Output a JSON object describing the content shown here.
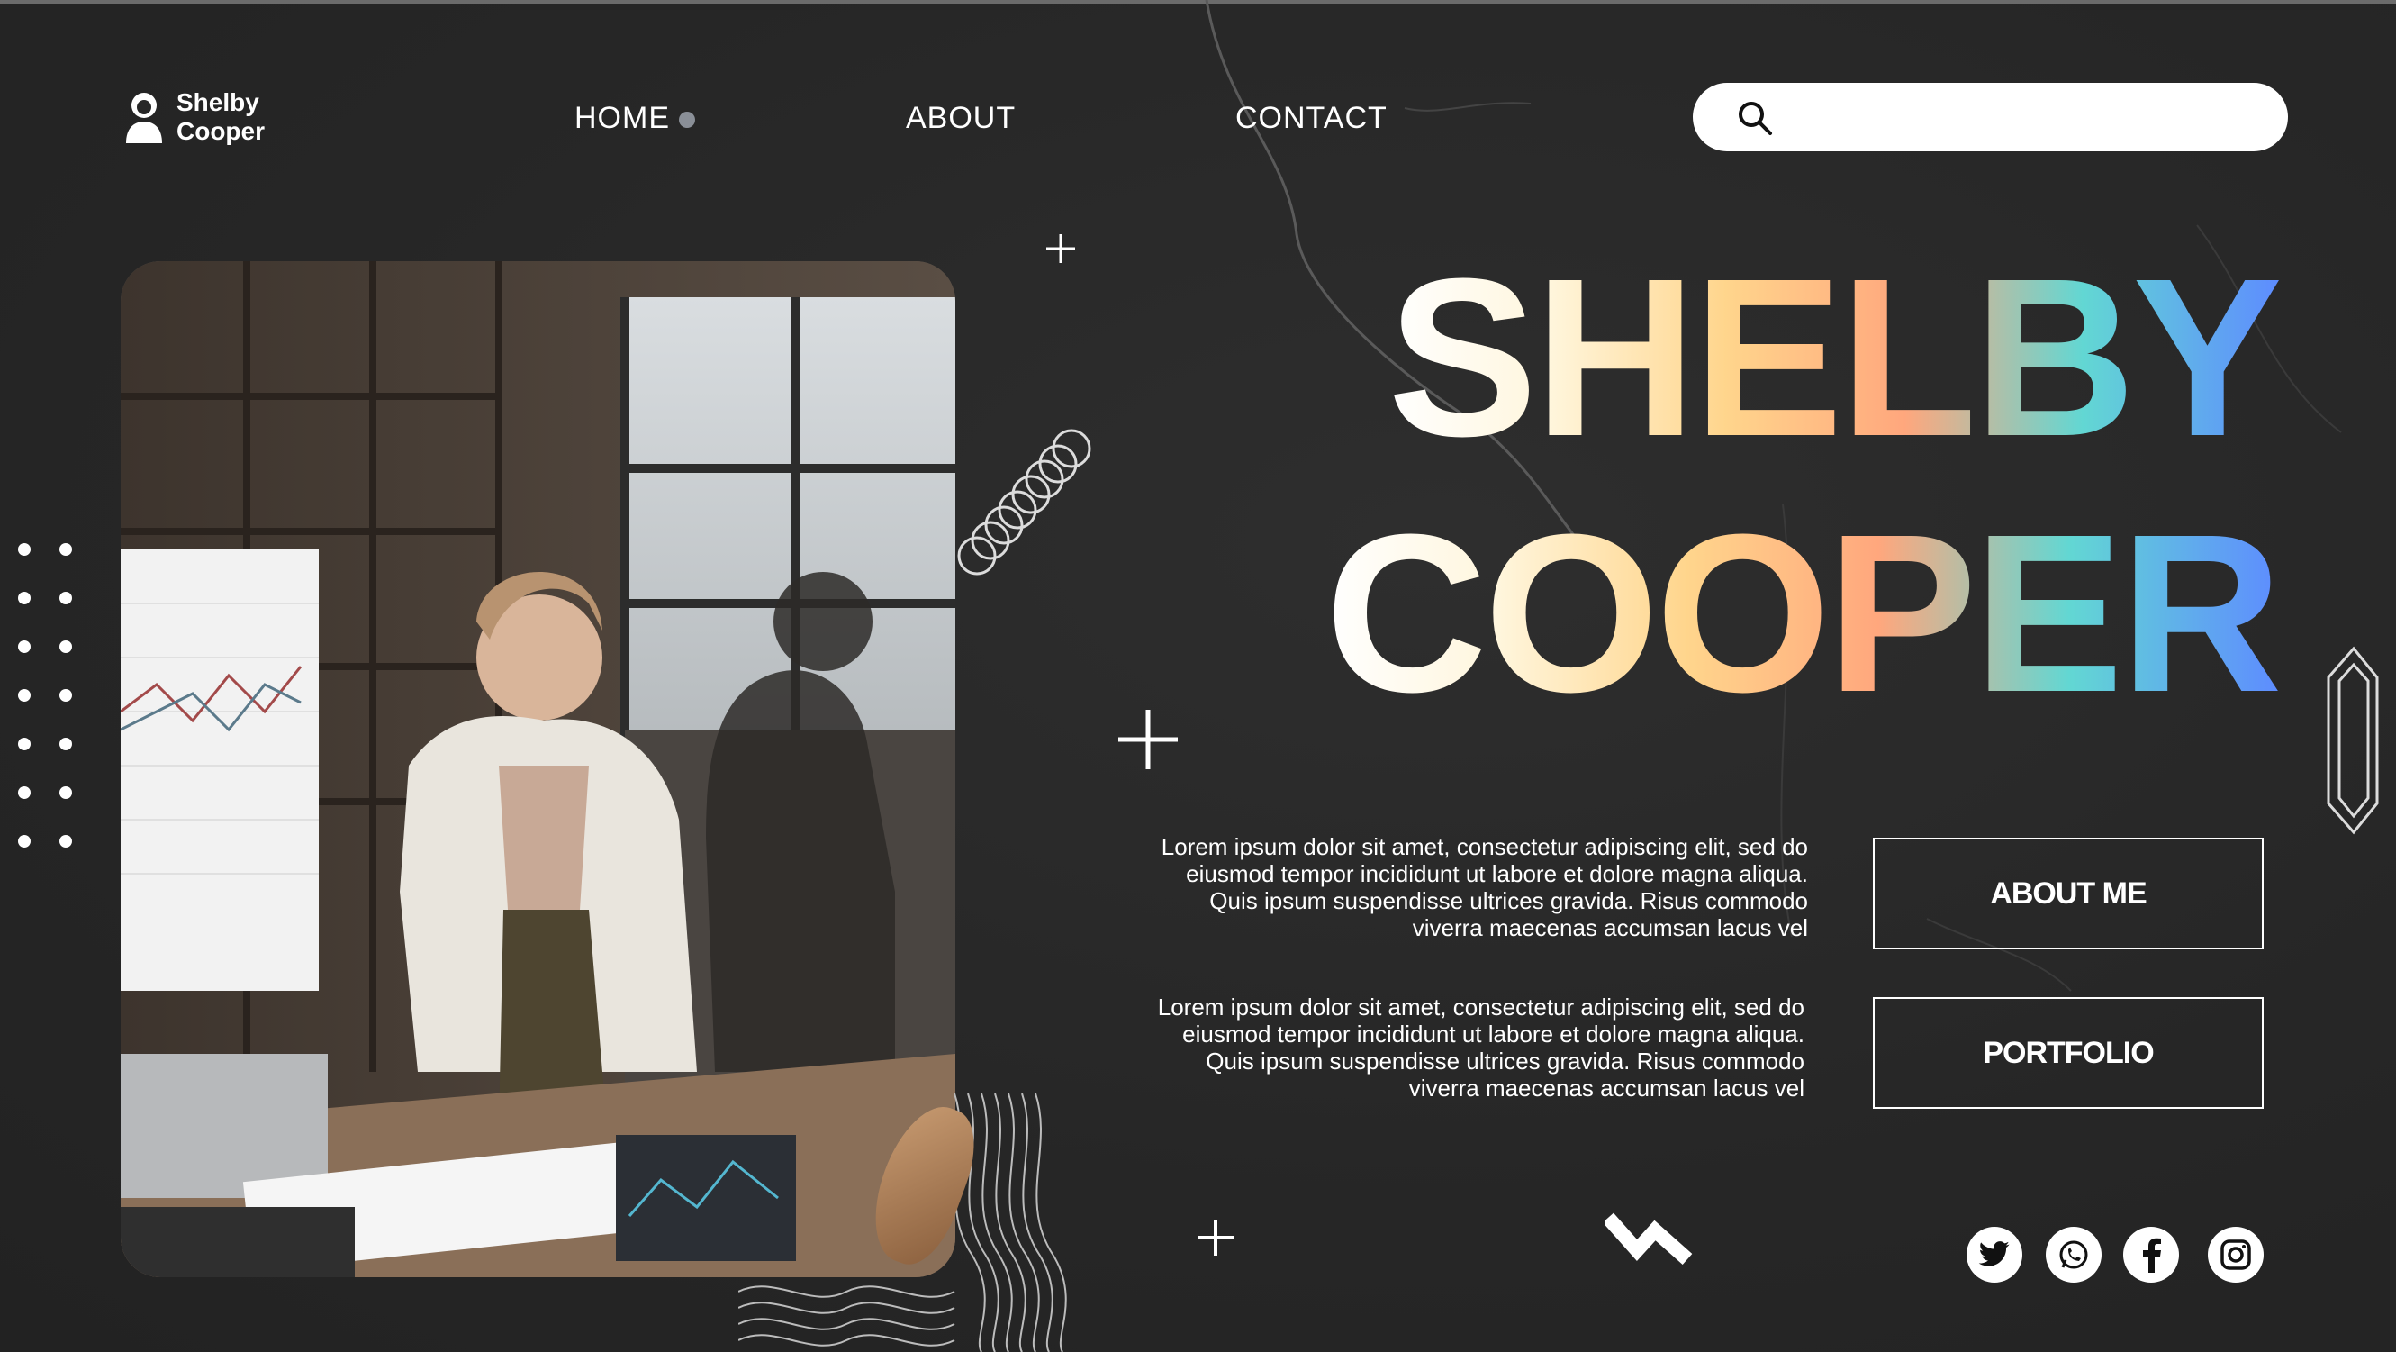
{
  "brand": {
    "line1": "Shelby",
    "line2": "Cooper"
  },
  "nav": {
    "home": "HOME",
    "about": "ABOUT",
    "contact": "CONTACT"
  },
  "search": {
    "placeholder": ""
  },
  "hero": {
    "title_line1": "SHELBY",
    "title_line2": "COOPER"
  },
  "paragraphs": [
    "Lorem ipsum dolor sit amet, consectetur adipiscing elit, sed do eiusmod tempor incididunt ut labore et dolore magna aliqua. Quis ipsum suspendisse ultrices gravida. Risus commodo viverra maecenas accumsan lacus vel",
    "Lorem ipsum dolor sit amet, consectetur adipiscing elit, sed do eiusmod tempor incididunt ut labore et dolore magna aliqua. Quis ipsum suspendisse ultrices gravida. Risus commodo viverra maecenas accumsan lacus vel"
  ],
  "buttons": {
    "about_me": "ABOUT ME",
    "portfolio": "PORTFOLIO"
  },
  "social": [
    "twitter-icon",
    "whatsapp-icon",
    "facebook-icon",
    "instagram-icon"
  ],
  "colors": {
    "background": "#272727",
    "gradient": [
      "#ffffff",
      "#ffd58c",
      "#ffa77d",
      "#62d7d3",
      "#5e8cff"
    ]
  }
}
